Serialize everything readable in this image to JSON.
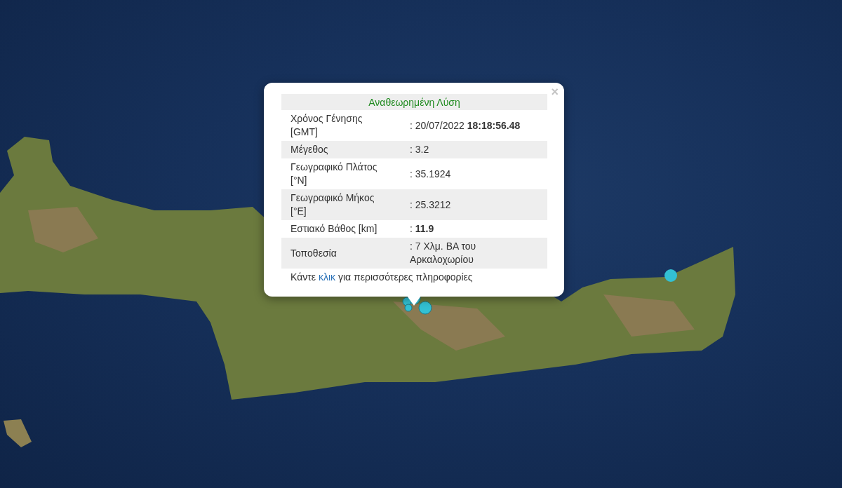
{
  "popup": {
    "close": "×",
    "title": "Αναθεωρημένη Λύση",
    "rows": [
      {
        "label": "Χρόνος Γένησης [GMT]",
        "value": ": 20/07/2022 **18:18:56.48**"
      },
      {
        "label": "Μέγεθος",
        "value": ": 3.2"
      },
      {
        "label": "Γεωγραφικό Πλάτος [°N]",
        "value": ": 35.1924"
      },
      {
        "label": "Γεωγραφικό Μήκος [°E]",
        "value": ": 25.3212"
      },
      {
        "label": "Εστιακό Βάθος [km]",
        "value": ": **11.9**"
      },
      {
        "label": "Τοποθεσία",
        "value": ": 7 Χλμ. ΒΑ του Αρκαλοχωρίου"
      }
    ],
    "footer": {
      "before": "Κάντε ",
      "link": "κλικ",
      "after": " για περισσότερες πληροφορίες"
    }
  }
}
